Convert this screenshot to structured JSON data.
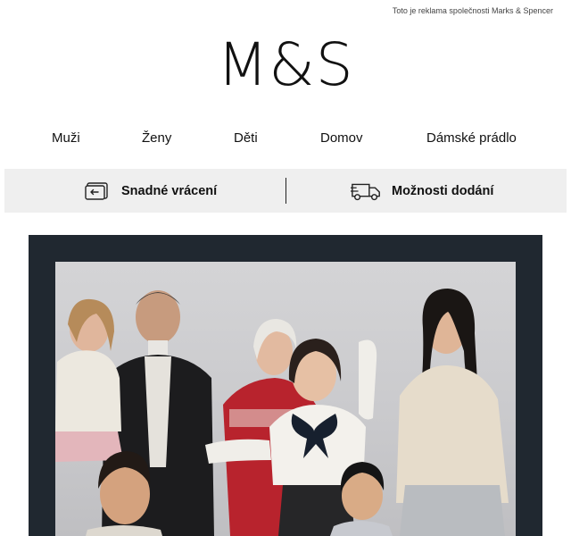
{
  "header": {
    "ad_note": "Toto je reklama společnosti Marks & Spencer",
    "logo": "M&S"
  },
  "nav": {
    "items": [
      {
        "label": "Muži"
      },
      {
        "label": "Ženy"
      },
      {
        "label": "Děti"
      },
      {
        "label": "Domov"
      },
      {
        "label": "Dámské prádlo"
      }
    ]
  },
  "services": {
    "items": [
      {
        "label": "Snadné vrácení",
        "icon": "returns-card-icon"
      },
      {
        "label": "Možnosti dodání",
        "icon": "delivery-truck-icon"
      }
    ],
    "background": "#efefef"
  },
  "hero": {
    "frame_color": "#202830",
    "image": "family-christmas-knitwear-photo"
  }
}
